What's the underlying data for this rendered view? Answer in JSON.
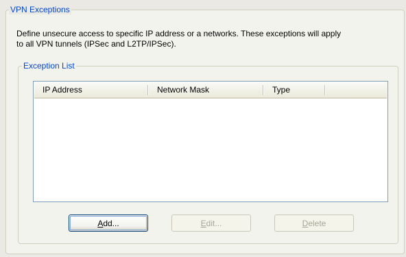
{
  "vpn_exceptions": {
    "group_title": "VPN Exceptions",
    "description_line1": "Define unsecure access to specific IP address or a networks.  These exceptions will apply",
    "description_line2": "to all VPN tunnels (IPSec and L2TP/IPSec).",
    "exception_list": {
      "group_title": "Exception List",
      "columns": [
        "IP Address",
        "Network Mask",
        "Type"
      ],
      "rows": []
    },
    "buttons": {
      "add": {
        "mnemonic": "A",
        "rest": "dd...",
        "enabled": true
      },
      "edit": {
        "mnemonic": "E",
        "rest": "dit...",
        "enabled": false
      },
      "delete": {
        "mnemonic": "D",
        "rest": "elete",
        "enabled": false
      }
    }
  },
  "colors": {
    "group_title": "#0046d5",
    "window_background": "#ebe9e4",
    "list_border": "#7f9db9",
    "disabled_text": "#a7a596"
  }
}
